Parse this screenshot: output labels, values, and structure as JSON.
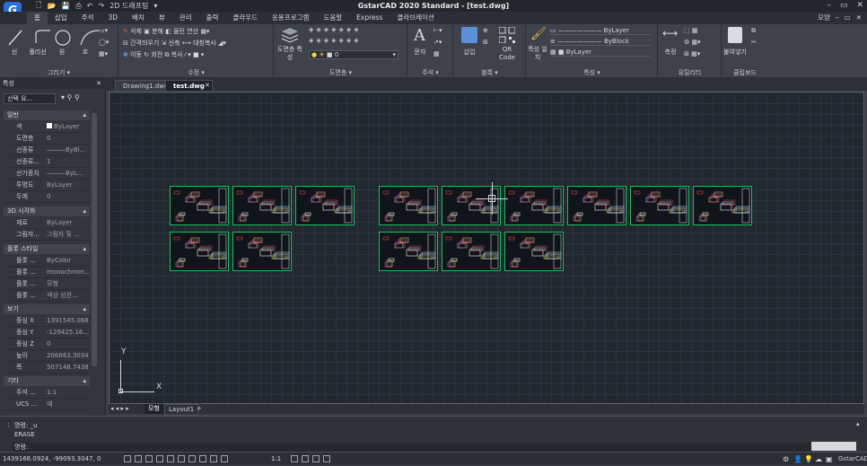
{
  "app": {
    "logo_letter": "G",
    "title": "GstarCAD 2020 Standard - [test.dwg]",
    "workspace": "2D 드래프팅",
    "window_controls": [
      "–",
      "▭",
      "✕"
    ]
  },
  "menu": {
    "items": [
      "홈",
      "삽입",
      "주석",
      "3D",
      "배치",
      "뷰",
      "관리",
      "출력",
      "클라우드",
      "응용프로그램",
      "도움말",
      "Express",
      "클라브레이션"
    ],
    "right_label": "모양",
    "right_controls": [
      "–",
      "▭",
      "✕"
    ]
  },
  "ribbon": {
    "groups": {
      "draw": {
        "label": "그리기 ▾",
        "line": "선",
        "polyline": "폴리선",
        "circle": "원",
        "arc": "호"
      },
      "modify": {
        "label": "수정 ▾",
        "row1": [
          "삭제",
          "분해",
          "물린 연산"
        ],
        "row2": [
          "간격띄우기",
          "신축",
          "대칭복사"
        ],
        "row3": [
          "이동",
          "회전",
          "복사"
        ]
      },
      "layers": {
        "label": "도면층 ▾",
        "layer_props": "도면층 특성",
        "current_layer": "0"
      },
      "annotation": {
        "label": "주석 ▾",
        "text": "문자"
      },
      "block": {
        "label": "블록 ▾",
        "insert": "삽입",
        "qr": "QR Code"
      },
      "properties": {
        "label": "특성 ▾",
        "match": "특성 일치",
        "color": "ByLayer",
        "linetype": "ByLayer",
        "lineweight": "ByBlock",
        "plotstyle": "ByLayer"
      },
      "utilities": {
        "label": "유틸리티",
        "measure": "측정"
      },
      "clipboard": {
        "label": "클립보드",
        "paste": "붙여넣기"
      }
    }
  },
  "properties_panel": {
    "title": "특성",
    "close": "✕",
    "select_value": "선택 요...",
    "sections": [
      {
        "name": "일반",
        "rows": [
          {
            "key": "색",
            "value": "ByLayer"
          },
          {
            "key": "도면층",
            "value": "0"
          },
          {
            "key": "선종류",
            "value": "———ByBl..."
          },
          {
            "key": "선종류...",
            "value": "1"
          },
          {
            "key": "선가중치",
            "value": "———ByL..."
          },
          {
            "key": "투명도",
            "value": "ByLayer"
          },
          {
            "key": "두께",
            "value": "0"
          }
        ]
      },
      {
        "name": "3D 시각화",
        "rows": [
          {
            "key": "재료",
            "value": "ByLayer"
          },
          {
            "key": "그림자...",
            "value": "그림자 및 ..."
          }
        ]
      },
      {
        "name": "플롯 스타일",
        "rows": [
          {
            "key": "플롯 ...",
            "value": "ByColor"
          },
          {
            "key": "플롯 ...",
            "value": "monochrom..."
          },
          {
            "key": "플롯 ...",
            "value": "모형"
          },
          {
            "key": "플롯 ...",
            "value": "색상 상관..."
          }
        ]
      },
      {
        "name": "보기",
        "rows": [
          {
            "key": "중심 X",
            "value": "1391545.068"
          },
          {
            "key": "중심 Y",
            "value": "-129425.16..."
          },
          {
            "key": "중심 Z",
            "value": "0"
          },
          {
            "key": "높이",
            "value": "206663.3034"
          },
          {
            "key": "폭",
            "value": "507148.7438"
          }
        ]
      },
      {
        "name": "기타",
        "rows": [
          {
            "key": "주석 ...",
            "value": "1:1"
          },
          {
            "key": "UCS ...",
            "value": "예"
          }
        ]
      }
    ]
  },
  "doc_tabs": [
    {
      "label": "Drawing1.dwg",
      "active": false
    },
    {
      "label": "test.dwg",
      "active": true
    },
    {
      "label": "✕",
      "active": false
    }
  ],
  "ucs": {
    "x": "X",
    "y": "Y"
  },
  "layout_tabs": {
    "nav": "◂ ◂ ▸ ▸",
    "model": "모형",
    "layout1": "Layout1",
    "add": "+"
  },
  "command": {
    "lines": [
      "명령: _u",
      "ERASE",
      "명령:"
    ]
  },
  "status": {
    "coords": "1439166.0924, -99093.3047, 0",
    "scale": "1:1",
    "app_name": "GstarCAD"
  },
  "colors": {
    "sheet_border": "#18c05a",
    "canvas_bg": "#212830",
    "accent_blue": "#2a6fd6"
  }
}
